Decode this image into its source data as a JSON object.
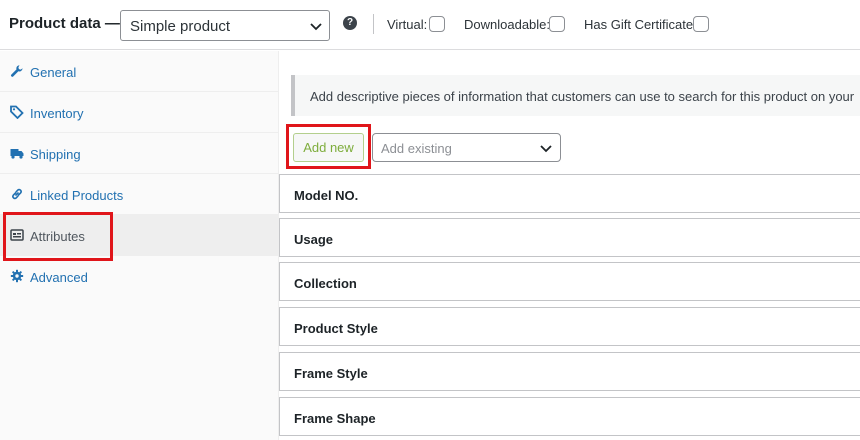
{
  "header": {
    "title": "Product data —",
    "product_type": "Simple product",
    "options": [
      {
        "label": "Virtual:",
        "checked": false
      },
      {
        "label": "Downloadable:",
        "checked": false
      },
      {
        "label": "Has Gift Certificate:",
        "checked": false
      }
    ]
  },
  "sidebar": {
    "items": [
      {
        "label": "General",
        "icon": "wrench-icon"
      },
      {
        "label": "Inventory",
        "icon": "tag-icon"
      },
      {
        "label": "Shipping",
        "icon": "truck-icon"
      },
      {
        "label": "Linked Products",
        "icon": "link-icon"
      },
      {
        "label": "Attributes",
        "icon": "list-view-icon",
        "active": true
      },
      {
        "label": "Advanced",
        "icon": "gear-icon"
      }
    ]
  },
  "main": {
    "notice": "Add descriptive pieces of information that customers can use to search for this product on your",
    "add_new_label": "Add new",
    "add_existing_placeholder": "Add existing",
    "attributes": [
      "Model NO.",
      "Usage",
      "Collection",
      "Product Style",
      "Frame Style",
      "Frame Shape"
    ]
  },
  "colors": {
    "link": "#2271b1",
    "highlight": "#e0151a",
    "add_new_text": "#7ead3c"
  }
}
